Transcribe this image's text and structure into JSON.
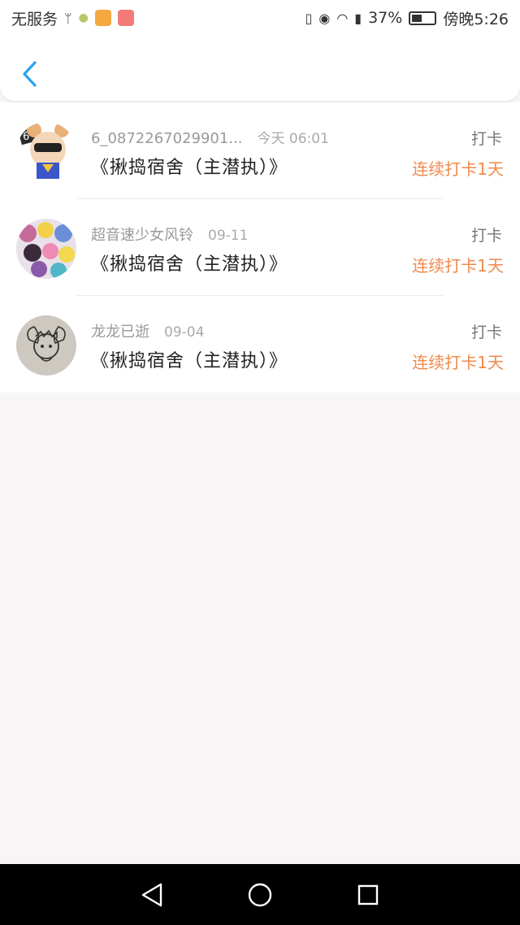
{
  "status_bar": {
    "carrier": "无服务",
    "battery": "37%",
    "time": "傍晚5:26",
    "app_icon_colors": [
      "#f3a840",
      "#f27b78"
    ]
  },
  "header": {
    "back_icon": "chevron-left-icon",
    "accent": "#2aa3f0"
  },
  "checkins": [
    {
      "user": "6_0872267029901...",
      "time": "今天 06:01",
      "title": "《揪捣宿舍（主潜执）》",
      "type": "打卡",
      "streak": "连续打卡1天"
    },
    {
      "user": "超音速少女风铃",
      "time": "09-11",
      "title": "《揪捣宿舍（主潜执）》",
      "type": "打卡",
      "streak": "连续打卡1天"
    },
    {
      "user": "龙龙已逝",
      "time": "09-04",
      "title": "《揪捣宿舍（主潜执）》",
      "type": "打卡",
      "streak": "连续打卡1天"
    }
  ],
  "colors": {
    "streak": "#f0894b",
    "page_bg": "#f7f5f6"
  },
  "nav": {
    "back": "triangle-back-icon",
    "home": "circle-home-icon",
    "recent": "square-recent-icon"
  }
}
